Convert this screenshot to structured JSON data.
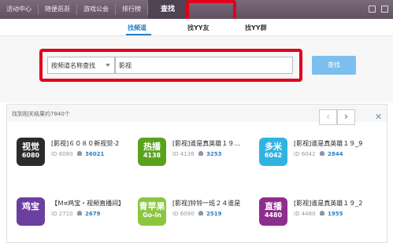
{
  "nav": {
    "items": [
      "活动中心",
      "随便逛逛",
      "游戏公会",
      "排行榜",
      "查找"
    ],
    "active": "查找"
  },
  "subtabs": [
    "找频道",
    "找YY友",
    "找YY群"
  ],
  "search": {
    "select_value": "按频道名称查找",
    "query": "影视",
    "button_label": "查找"
  },
  "results": {
    "summary": "找到相关结果约7840个",
    "cards": [
      {
        "logo_top": "视觉",
        "logo_bottom": "6080",
        "logo_color": "#2b2b2b",
        "title": "[影视]６０８０新视觉-2",
        "id_label": "ID",
        "id": "6080",
        "count": "36021"
      },
      {
        "logo_top": "热播",
        "logo_bottom": "4138",
        "logo_color": "#5aa21d",
        "title": "[影视]谁是真英雄１９...",
        "id_label": "ID",
        "id": "4138",
        "count": "3253"
      },
      {
        "logo_top": "多米",
        "logo_bottom": "6042",
        "logo_color": "#2fb3e2",
        "title": "[影视]谁是真英雄１９_9",
        "id_label": "ID",
        "id": "6042",
        "count": "2844"
      },
      {
        "logo_top": "鸡宝",
        "logo_bottom": "",
        "logo_color": "#6b3fa0",
        "title": "【Ｍ¤鸡宝・视频直播间】",
        "id_label": "ID",
        "id": "2710",
        "count": "2679"
      },
      {
        "logo_top": "青苹果",
        "logo_bottom": "Go-in",
        "logo_color": "#8cc63f",
        "title": "[影视]铃铃一班２４谁是",
        "id_label": "ID",
        "id": "6090",
        "count": "2519"
      },
      {
        "logo_top": "直播",
        "logo_bottom": "4480",
        "logo_color": "#8e2d8f",
        "title": "[影视]谁是真英雄１９_2",
        "id_label": "ID",
        "id": "4480",
        "count": "1955"
      }
    ]
  }
}
